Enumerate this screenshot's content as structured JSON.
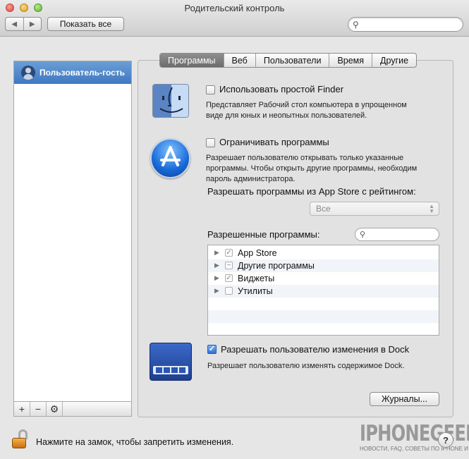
{
  "window": {
    "title": "Родительский контроль"
  },
  "toolbar": {
    "back": "◀",
    "forward": "▶",
    "show_all": "Показать все",
    "search_placeholder": ""
  },
  "sidebar": {
    "items": [
      {
        "label": "Пользователь-гость"
      }
    ],
    "footer": {
      "add": "+",
      "remove": "−",
      "gear": "⚙"
    }
  },
  "tabs": [
    {
      "label": "Программы",
      "active": true
    },
    {
      "label": "Веб",
      "active": false
    },
    {
      "label": "Пользователи",
      "active": false
    },
    {
      "label": "Время",
      "active": false
    },
    {
      "label": "Другие",
      "active": false
    }
  ],
  "finder": {
    "checkbox_label": "Использовать простой Finder",
    "checked": false,
    "desc_line1": "Представляет Рабочий стол компьютера в упрощенном",
    "desc_line2": "виде для юных и неопытных пользователей."
  },
  "restrict": {
    "checkbox_label": "Ограничивать программы",
    "checked": false,
    "desc_line1": "Разрешает пользователю открывать только указанные",
    "desc_line2": "программы. Чтобы открыть другие программы, необходим",
    "desc_line3": "пароль администратора."
  },
  "appstore_rating": {
    "label": "Разрешать программы из App Store с рейтингом:",
    "selected": "Все"
  },
  "allowed": {
    "label": "Разрешенные программы:",
    "items": [
      {
        "label": "App Store",
        "state": "checked"
      },
      {
        "label": "Другие программы",
        "state": "mixed"
      },
      {
        "label": "Виджеты",
        "state": "checked"
      },
      {
        "label": "Утилиты",
        "state": "unchecked"
      }
    ]
  },
  "dock": {
    "checkbox_label": "Разрешать пользователю изменения в Dock",
    "checked": true,
    "desc": "Разрешает пользователю изменять содержимое Dock."
  },
  "logs_button": "Журналы...",
  "lock_text": "Нажмите на замок, чтобы запретить изменения.",
  "help": "?",
  "watermark": {
    "brand": "IPHONEGEEK",
    "tagline": "НОВОСТИ, FAQ, СОВЕТЫ ПО IPHONE И IPAD"
  },
  "colors": {
    "accent": "#3f77c2",
    "tab_active": "#7a7a7a",
    "lock": "#e59a35"
  }
}
